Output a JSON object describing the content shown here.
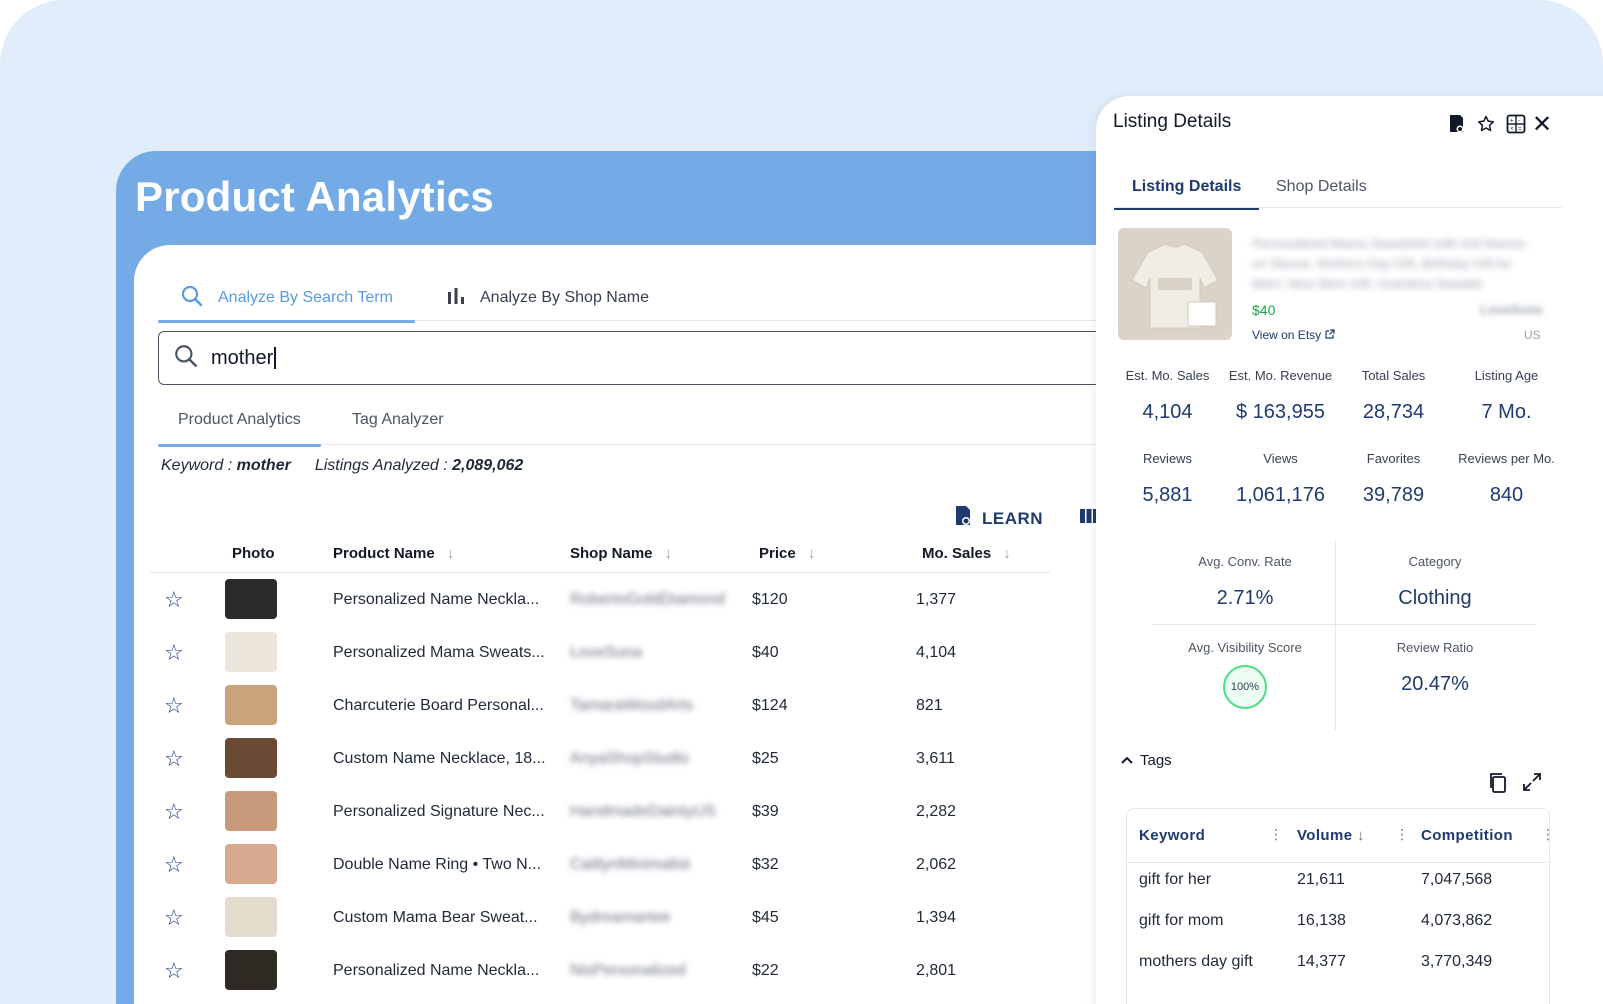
{
  "app": {
    "title": "Product Analytics",
    "mode_tabs": [
      "Analyze By Search Term",
      "Analyze By Shop Name"
    ],
    "search_value": "mother",
    "sub_tabs": [
      "Product Analytics",
      "Tag Analyzer"
    ],
    "keyword_label": "Keyword :",
    "keyword_value": "mother",
    "listings_label": "Listings Analyzed :",
    "listings_value": "2,089,062",
    "learn_label": "LEARN"
  },
  "table": {
    "columns": [
      "Photo",
      "Product Name",
      "Shop Name",
      "Price",
      "Mo. Sales"
    ],
    "rows": [
      {
        "name": "Personalized Name Neckla...",
        "shop": "RobertoGoldDiamond",
        "price": "$120",
        "sales": "1,377",
        "thumb": "#2b2b2b"
      },
      {
        "name": "Personalized Mama Sweats...",
        "shop": "LoveSuna",
        "price": "$40",
        "sales": "4,104",
        "thumb": "#ece6db"
      },
      {
        "name": "Charcuterie Board Personal...",
        "shop": "TamaraWoodArts",
        "price": "$124",
        "sales": "821",
        "thumb": "#c9a37a"
      },
      {
        "name": "Custom Name Necklace, 18...",
        "shop": "AnyaShopStudio",
        "price": "$25",
        "sales": "3,611",
        "thumb": "#6b4a35"
      },
      {
        "name": "Personalized Signature Nec...",
        "shop": "HandmadeDaintyUS",
        "price": "$39",
        "sales": "2,282",
        "thumb": "#c89a7c"
      },
      {
        "name": "Double Name Ring • Two N...",
        "shop": "CaitlynMinimalist",
        "price": "$32",
        "sales": "2,062",
        "thumb": "#d8a98e"
      },
      {
        "name": "Custom Mama Bear Sweat...",
        "shop": "Bydreamartee",
        "price": "$45",
        "sales": "1,394",
        "thumb": "#e3dccd"
      },
      {
        "name": "Personalized Name Neckla...",
        "shop": "NisPersonalized",
        "price": "$22",
        "sales": "2,801",
        "thumb": "#2f2a24"
      }
    ]
  },
  "drawer": {
    "title": "Listing Details",
    "tabs": [
      "Listing Details",
      "Shop Details"
    ],
    "product_title": "Personalized Mama Sweatshirt with Kid Names on Sleeve, Mothers Day Gift, Birthday Gift for Mom, New Mom Gift, Grandma Sweater",
    "price": "$40",
    "shop": "LoveSuna",
    "view_link": "View on Etsy",
    "country": "US",
    "stats": [
      {
        "label": "Est. Mo. Sales",
        "value": "4,104"
      },
      {
        "label": "Est. Mo. Revenue",
        "value": "$ 163,955"
      },
      {
        "label": "Total Sales",
        "value": "28,734"
      },
      {
        "label": "Listing Age",
        "value": "7 Mo."
      },
      {
        "label": "Reviews",
        "value": "5,881"
      },
      {
        "label": "Views",
        "value": "1,061,176"
      },
      {
        "label": "Favorites",
        "value": "39,789"
      },
      {
        "label": "Reviews per Mo.",
        "value": "840"
      }
    ],
    "conv_rate_label": "Avg. Conv. Rate",
    "conv_rate": "2.71%",
    "category_label": "Category",
    "category": "Clothing",
    "visibility_label": "Avg. Visibility Score",
    "visibility": "100%",
    "review_ratio_label": "Review Ratio",
    "review_ratio": "20.47%",
    "tags_label": "Tags",
    "tag_columns": [
      "Keyword",
      "Volume",
      "Competition"
    ],
    "tags": [
      {
        "keyword": "gift for her",
        "volume": "21,611",
        "competition": "7,047,568"
      },
      {
        "keyword": "gift for mom",
        "volume": "16,138",
        "competition": "4,073,862"
      },
      {
        "keyword": "mothers day gift",
        "volume": "14,377",
        "competition": "3,770,349"
      }
    ]
  },
  "colors": {
    "accent": "#74aae6",
    "navy": "#1e3a6e",
    "background": "#e2edfb",
    "success": "#16a34a"
  },
  "icons": [
    "search-icon",
    "bar-chart-icon",
    "learn-doc-icon",
    "columns-icon",
    "star-outline-icon",
    "save-listing-icon",
    "calculator-icon",
    "close-icon",
    "external-link-icon",
    "chevron-up-icon",
    "copy-icon",
    "expand-icon",
    "sort-arrow-icon",
    "kebab-icon"
  ]
}
